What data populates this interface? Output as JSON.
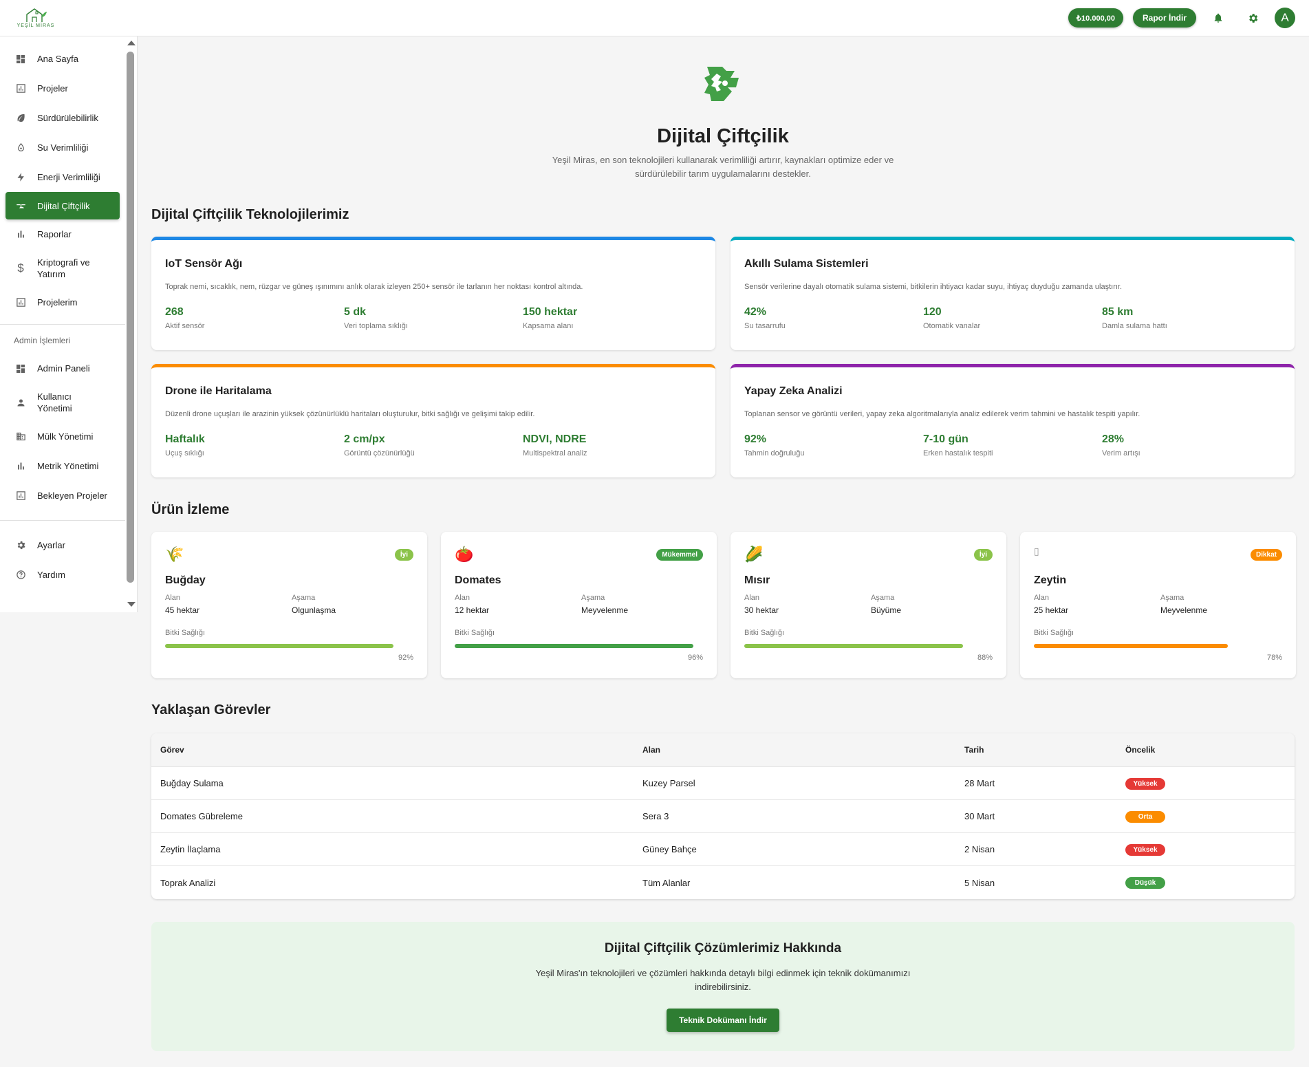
{
  "header": {
    "brand": "YEŞİL MİRAS",
    "balance": "₺10.000,00",
    "report_button": "Rapor İndir",
    "icons": [
      "bell-icon",
      "gear-icon"
    ],
    "avatar_letter": "A"
  },
  "sidebar": {
    "items": [
      {
        "label": "Ana Sayfa",
        "icon": "dashboard-icon"
      },
      {
        "label": "Projeler",
        "icon": "chart-box-icon"
      },
      {
        "label": "Sürdürülebilirlik",
        "icon": "leaf-icon"
      },
      {
        "label": "Su Verimliliği",
        "icon": "water-drop-icon"
      },
      {
        "label": "Enerji Verimliliği",
        "icon": "lightning-icon"
      },
      {
        "label": "Dijital Çiftçilik",
        "icon": "drone-icon",
        "active": true
      },
      {
        "label": "Raporlar",
        "icon": "bar-chart-icon"
      },
      {
        "label": "Kriptografi ve Yatırım",
        "icon": "dollar-icon"
      },
      {
        "label": "Projelerim",
        "icon": "chart-box-icon"
      }
    ],
    "admin_title": "Admin İşlemleri",
    "admin_items": [
      {
        "label": "Admin Paneli",
        "icon": "dashboard-icon"
      },
      {
        "label": "Kullanıcı Yönetimi",
        "icon": "person-icon"
      },
      {
        "label": "Mülk Yönetimi",
        "icon": "building-icon"
      },
      {
        "label": "Metrik Yönetimi",
        "icon": "bar-chart-icon"
      },
      {
        "label": "Bekleyen Projeler",
        "icon": "chart-box-icon"
      }
    ],
    "bottom_items": [
      {
        "label": "Ayarlar",
        "icon": "gear-icon"
      },
      {
        "label": "Yardım",
        "icon": "help-icon"
      }
    ]
  },
  "hero": {
    "icon": "drone-icon",
    "title": "Dijital Çiftçilik",
    "description": "Yeşil Miras, en son teknolojileri kullanarak verimliliği artırır, kaynakları optimize eder ve sürdürülebilir tarım uygulamalarını destekler."
  },
  "tech": {
    "title": "Dijital Çiftçilik Teknolojilerimiz",
    "cards": [
      {
        "title": "IoT Sensör Ağı",
        "color": "#1e88e5",
        "desc": "Toprak nemi, sıcaklık, nem, rüzgar ve güneş ışınımını anlık olarak izleyen 250+ sensör ile tarlanın her noktası kontrol altında.",
        "stats": [
          {
            "value": "268",
            "label": "Aktif sensör"
          },
          {
            "value": "5 dk",
            "label": "Veri toplama sıklığı"
          },
          {
            "value": "150 hektar",
            "label": "Kapsama alanı"
          }
        ]
      },
      {
        "title": "Akıllı Sulama Sistemleri",
        "color": "#00acc1",
        "desc": "Sensör verilerine dayalı otomatik sulama sistemi, bitkilerin ihtiyacı kadar suyu, ihtiyaç duyduğu zamanda ulaştırır.",
        "stats": [
          {
            "value": "42%",
            "label": "Su tasarrufu"
          },
          {
            "value": "120",
            "label": "Otomatik vanalar"
          },
          {
            "value": "85 km",
            "label": "Damla sulama hattı"
          }
        ]
      },
      {
        "title": "Drone ile Haritalama",
        "color": "#fb8c00",
        "desc": "Düzenli drone uçuşları ile arazinin yüksek çözünürlüklü haritaları oluşturulur, bitki sağlığı ve gelişimi takip edilir.",
        "stats": [
          {
            "value": "Haftalık",
            "label": "Uçuş sıklığı"
          },
          {
            "value": "2 cm/px",
            "label": "Görüntü çözünürlüğü"
          },
          {
            "value": "NDVI, NDRE",
            "label": "Multispektral analiz"
          }
        ]
      },
      {
        "title": "Yapay Zeka Analizi",
        "color": "#8e24aa",
        "desc": "Toplanan sensor ve görüntü verileri, yapay zeka algoritmalarıyla analiz edilerek verim tahmini ve hastalık tespiti yapılır.",
        "stats": [
          {
            "value": "92%",
            "label": "Tahmin doğruluğu"
          },
          {
            "value": "7-10 gün",
            "label": "Erken hastalık tespiti"
          },
          {
            "value": "28%",
            "label": "Verim artışı"
          }
        ]
      }
    ]
  },
  "crops": {
    "title": "Ürün İzleme",
    "area_label": "Alan",
    "stage_label": "Aşama",
    "health_label": "Bitki Sağlığı",
    "items": [
      {
        "emoji": "🌾",
        "name": "Buğday",
        "status": "İyi",
        "status_color": "#8bc34a",
        "area": "45 hektar",
        "stage": "Olgunlaşma",
        "health": 92,
        "health_text": "92%",
        "bar_color": "#8bc34a"
      },
      {
        "emoji": "🍅",
        "name": "Domates",
        "status": "Mükemmel",
        "status_color": "#43a047",
        "area": "12 hektar",
        "stage": "Meyvelenme",
        "health": 96,
        "health_text": "96%",
        "bar_color": "#43a047"
      },
      {
        "emoji": "🌽",
        "name": "Mısır",
        "status": "İyi",
        "status_color": "#8bc34a",
        "area": "30 hektar",
        "stage": "Büyüme",
        "health": 88,
        "health_text": "88%",
        "bar_color": "#8bc34a"
      },
      {
        "emoji": "",
        "name": "Zeytin",
        "status": "Dikkat",
        "status_color": "#fb8c00",
        "area": "25 hektar",
        "stage": "Meyvelenme",
        "health": 78,
        "health_text": "78%",
        "bar_color": "#fb8c00"
      }
    ]
  },
  "tasks": {
    "title": "Yaklaşan Görevler",
    "columns": [
      "Görev",
      "Alan",
      "Tarih",
      "Öncelik"
    ],
    "rows": [
      {
        "task": "Buğday Sulama",
        "area": "Kuzey Parsel",
        "date": "28 Mart",
        "priority": "Yüksek",
        "color": "#e53935"
      },
      {
        "task": "Domates Gübreleme",
        "area": "Sera 3",
        "date": "30 Mart",
        "priority": "Orta",
        "color": "#fb8c00"
      },
      {
        "task": "Zeytin İlaçlama",
        "area": "Güney Bahçe",
        "date": "2 Nisan",
        "priority": "Yüksek",
        "color": "#e53935"
      },
      {
        "task": "Toprak Analizi",
        "area": "Tüm Alanlar",
        "date": "5 Nisan",
        "priority": "Düşük",
        "color": "#43a047"
      }
    ]
  },
  "about": {
    "title": "Dijital Çiftçilik Çözümlerimiz Hakkında",
    "text": "Yeşil Miras'ın teknolojileri ve çözümleri hakkında detaylı bilgi edinmek için teknik dokümanımızı indirebilirsiniz.",
    "button": "Teknik Dokümanı İndir"
  }
}
